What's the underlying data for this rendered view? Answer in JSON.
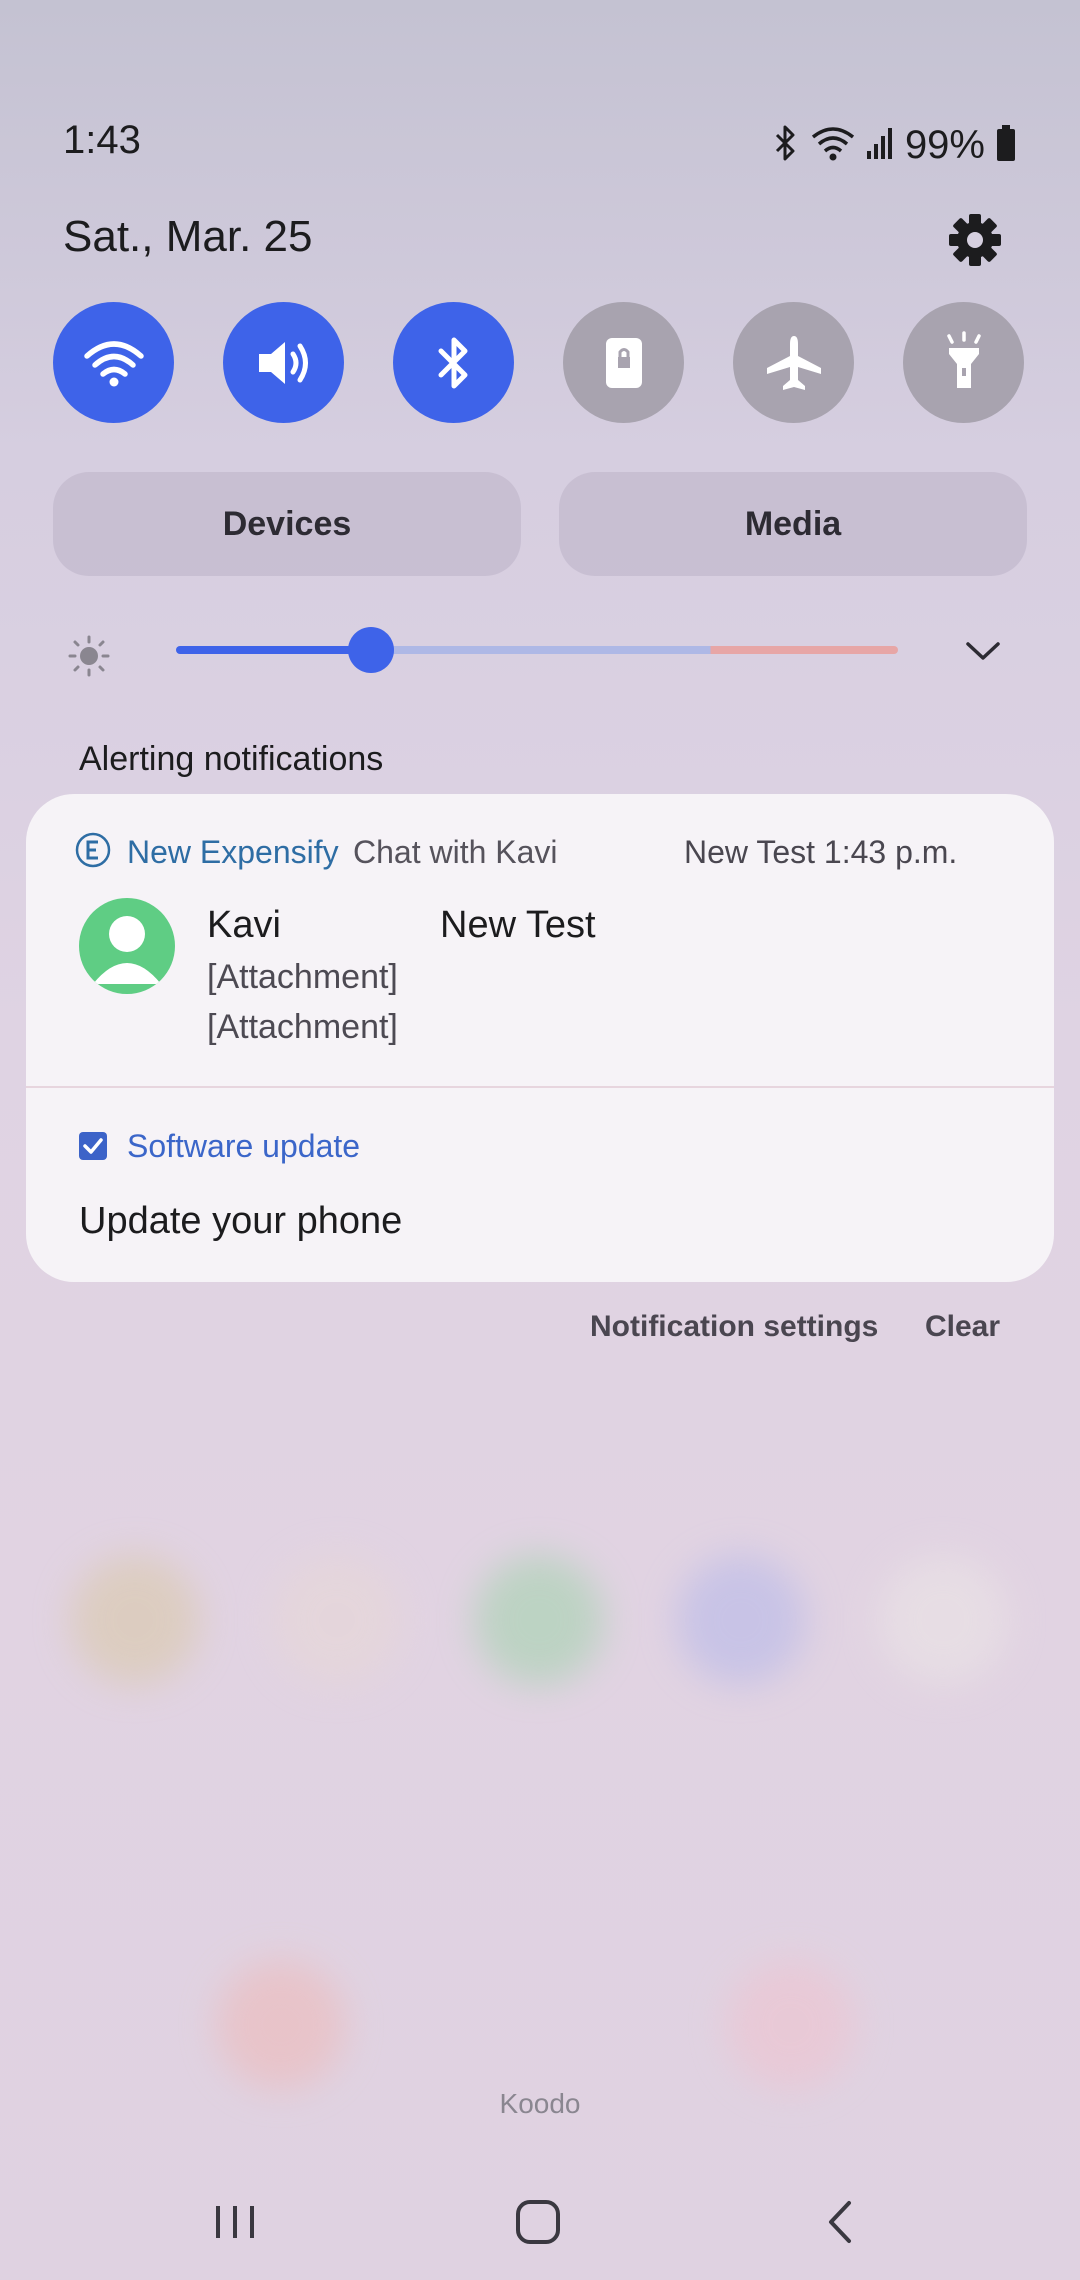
{
  "status_bar": {
    "time": "1:43",
    "battery": "99%",
    "icons": [
      "bluetooth-icon",
      "wifi-icon",
      "signal-icon",
      "battery-icon"
    ]
  },
  "header": {
    "date": "Sat., Mar. 25",
    "settings_icon": "gear-icon"
  },
  "quick_toggles": [
    {
      "name": "wifi",
      "icon": "wifi-icon",
      "state": "on"
    },
    {
      "name": "sound",
      "icon": "volume-icon",
      "state": "on"
    },
    {
      "name": "bluetooth",
      "icon": "bluetooth-icon",
      "state": "on"
    },
    {
      "name": "portrait-lock",
      "icon": "lock-icon",
      "state": "off"
    },
    {
      "name": "airplane-mode",
      "icon": "airplane-icon",
      "state": "off"
    },
    {
      "name": "flashlight",
      "icon": "flashlight-icon",
      "state": "off"
    }
  ],
  "panels": {
    "devices": "Devices",
    "media": "Media"
  },
  "brightness": {
    "level": 0.27
  },
  "notifications": {
    "section_title": "Alerting notifications",
    "expensify": {
      "app_name": "New Expensify",
      "subtitle": "Chat with Kavi",
      "right_info": "New Test  1:43 p.m.",
      "sender": "Kavi",
      "conversation": "New Test",
      "line1": "[Attachment]",
      "line2": "[Attachment]"
    },
    "software_update": {
      "title": "Software update",
      "body": "Update your phone"
    },
    "settings_label": "Notification settings",
    "clear_label": "Clear"
  },
  "carrier": "Koodo",
  "colors": {
    "accent": "#3e63e9",
    "toggle_off": "#a8a3af",
    "expensify_text": "#2e6da4",
    "update_text": "#3b66c9"
  }
}
